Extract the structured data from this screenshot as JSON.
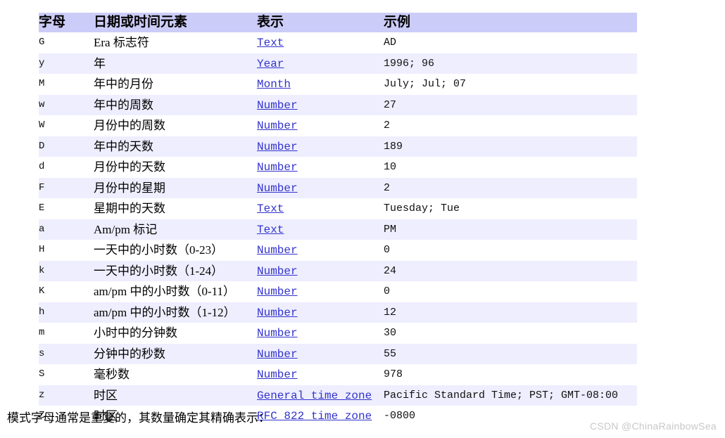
{
  "table": {
    "headers": {
      "letter": "字母",
      "element": "日期或时间元素",
      "presentation": "表示",
      "example": "示例"
    },
    "rows": [
      {
        "letter": "G",
        "element": "Era 标志符",
        "presentation": "Text",
        "example": "AD"
      },
      {
        "letter": "y",
        "element": "年",
        "presentation": "Year",
        "example": "1996; 96"
      },
      {
        "letter": "M",
        "element": "年中的月份",
        "presentation": "Month",
        "example": "July; Jul; 07"
      },
      {
        "letter": "w",
        "element": "年中的周数",
        "presentation": "Number",
        "example": "27"
      },
      {
        "letter": "W",
        "element": "月份中的周数",
        "presentation": "Number",
        "example": "2"
      },
      {
        "letter": "D",
        "element": "年中的天数",
        "presentation": "Number",
        "example": "189"
      },
      {
        "letter": "d",
        "element": "月份中的天数",
        "presentation": "Number",
        "example": "10"
      },
      {
        "letter": "F",
        "element": "月份中的星期",
        "presentation": "Number",
        "example": "2"
      },
      {
        "letter": "E",
        "element": "星期中的天数",
        "presentation": "Text",
        "example": "Tuesday; Tue"
      },
      {
        "letter": "a",
        "element": "Am/pm 标记",
        "presentation": "Text",
        "example": "PM"
      },
      {
        "letter": "H",
        "element": "一天中的小时数（0-23）",
        "presentation": "Number",
        "example": "0"
      },
      {
        "letter": "k",
        "element": "一天中的小时数（1-24）",
        "presentation": "Number",
        "example": "24"
      },
      {
        "letter": "K",
        "element": "am/pm 中的小时数（0-11）",
        "presentation": "Number",
        "example": "0"
      },
      {
        "letter": "h",
        "element": "am/pm 中的小时数（1-12）",
        "presentation": "Number",
        "example": "12"
      },
      {
        "letter": "m",
        "element": "小时中的分钟数",
        "presentation": "Number",
        "example": "30"
      },
      {
        "letter": "s",
        "element": "分钟中的秒数",
        "presentation": "Number",
        "example": "55"
      },
      {
        "letter": "S",
        "element": "毫秒数",
        "presentation": "Number",
        "example": "978"
      },
      {
        "letter": "z",
        "element": "时区",
        "presentation": "General time zone",
        "example": "Pacific Standard Time; PST; GMT-08:00"
      },
      {
        "letter": "Z",
        "element": "时区",
        "presentation": "RFC 822 time zone",
        "example": "-0800"
      }
    ]
  },
  "caption": "模式字母通常是重复的，其数量确定其精确表示：",
  "watermark": "CSDN @ChinaRainbowSea",
  "colors": {
    "header_background": "#ccccf8",
    "row_alt_background": "#eeeeff",
    "row_background": "#ffffff",
    "link": "#3333cc",
    "text": "#000000",
    "watermark": "#c8c8c8"
  }
}
